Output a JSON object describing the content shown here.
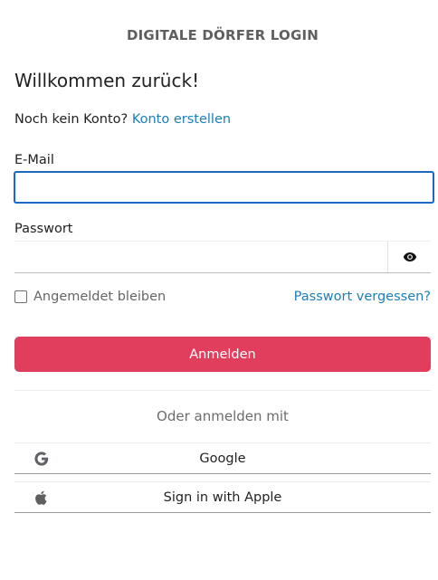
{
  "header": {
    "title": "DIGITALE DÖRFER LOGIN"
  },
  "welcome": "Willkommen zurück!",
  "signup": {
    "prompt": "Noch kein Konto?",
    "link_label": "Konto erstellen"
  },
  "form": {
    "email_label": "E-Mail",
    "email_value": "",
    "password_label": "Passwort",
    "password_value": "",
    "remember_label": "Angemeldet bleiben",
    "remember_checked": false,
    "forgot_label": "Passwort vergessen?",
    "submit_label": "Anmelden"
  },
  "alternatives": {
    "heading": "Oder anmelden mit",
    "google_label": "Google",
    "apple_label": "Sign in with Apple"
  },
  "colors": {
    "accent_button": "#e13e5e",
    "link": "#1d7fb5",
    "focus_border": "#1b68c9"
  },
  "icons": {
    "password_toggle": "eye-icon",
    "google": "google-icon",
    "apple": "apple-icon"
  }
}
